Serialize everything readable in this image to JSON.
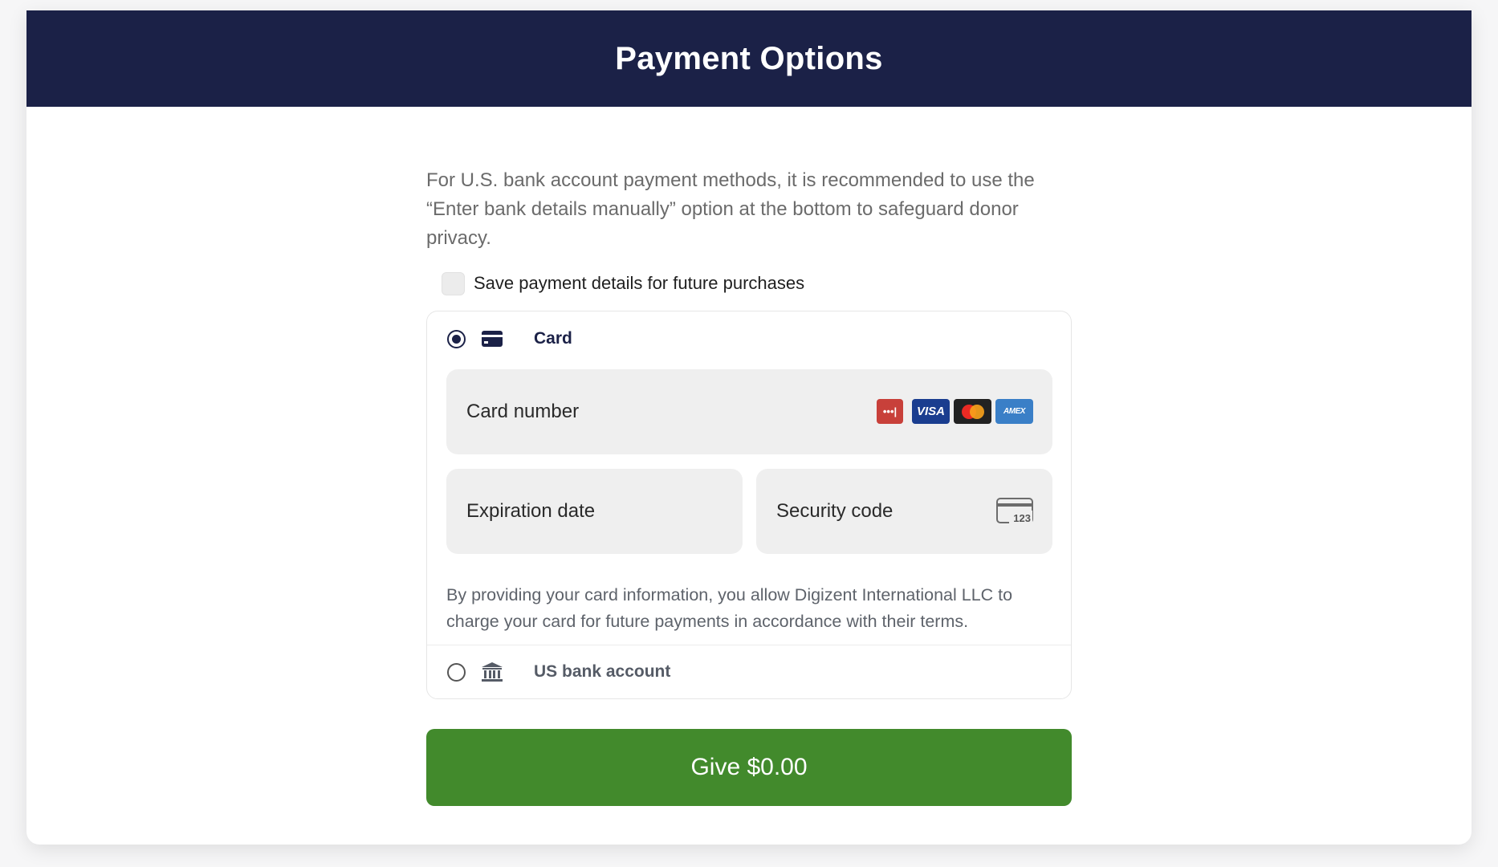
{
  "modal": {
    "title": "Payment Options"
  },
  "notice": "For U.S. bank account payment methods, it is recommended to use the “Enter bank details manually” option at the bottom to safeguard donor privacy.",
  "save_details": {
    "label": "Save payment details for future purchases",
    "checked": false
  },
  "methods": {
    "card": {
      "label": "Card",
      "selected": true,
      "icon": "credit-card-icon",
      "card_number_placeholder": "Card number",
      "expiration_placeholder": "Expiration date",
      "security_code_placeholder": "Security code",
      "cvc_icon_text": "123",
      "brands": [
        {
          "name": "other-card-icon",
          "label": "•••|"
        },
        {
          "name": "visa-icon",
          "label": "VISA"
        },
        {
          "name": "mastercard-icon",
          "label": ""
        },
        {
          "name": "amex-icon",
          "label": "AMEX"
        }
      ],
      "disclaimer": "By providing your card information, you allow Digizent International LLC to charge your card for future payments in accordance with their terms."
    },
    "bank": {
      "label": "US bank account",
      "selected": false,
      "icon": "bank-icon"
    }
  },
  "give_button": {
    "label": "Give $0.00"
  },
  "colors": {
    "header_bg": "#1b2147",
    "button_bg": "#428a2c",
    "field_bg": "#efefef"
  }
}
